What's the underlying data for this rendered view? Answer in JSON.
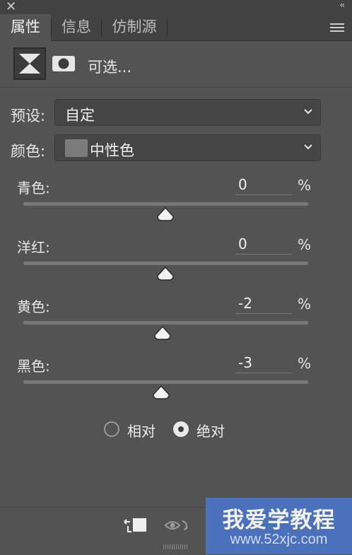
{
  "window": {
    "close_glyph": "✕",
    "collapse_glyph": "‹‹"
  },
  "tabs": [
    {
      "label": "属性",
      "active": true
    },
    {
      "label": "信息",
      "active": false
    },
    {
      "label": "仿制源",
      "active": false
    }
  ],
  "panel": {
    "adjustment_title": "可选..."
  },
  "preset": {
    "label": "预设:",
    "value": "自定"
  },
  "colors": {
    "label": "颜色:",
    "value": "中性色",
    "swatch": "#7b7b7b"
  },
  "sliders": [
    {
      "label": "青色:",
      "value": "0",
      "unit": "%"
    },
    {
      "label": "洋红:",
      "value": "0",
      "unit": "%"
    },
    {
      "label": "黄色:",
      "value": "-2",
      "unit": "%"
    },
    {
      "label": "黑色:",
      "value": "-3",
      "unit": "%"
    }
  ],
  "method": {
    "relative_label": "相对",
    "absolute_label": "绝对",
    "selected": "绝对"
  },
  "watermark": {
    "line1": "我爱学教程",
    "line2": "www.52xjc.com"
  }
}
